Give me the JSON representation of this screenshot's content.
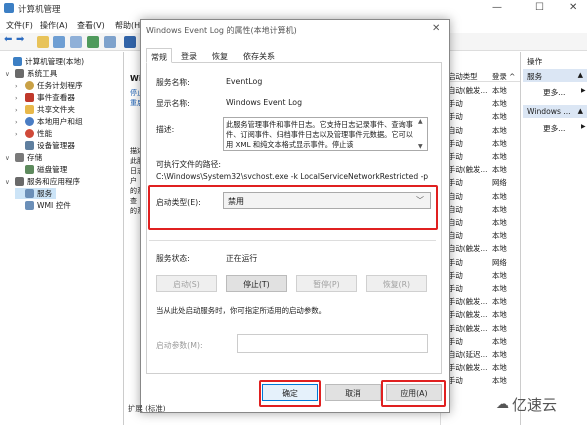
{
  "window": {
    "title": "计算机管理",
    "controls": [
      "—",
      "☐",
      "✕"
    ]
  },
  "menu": [
    "文件(F)",
    "操作(A)",
    "查看(V)",
    "帮助(H)"
  ],
  "tree": {
    "items": [
      {
        "label": "计算机管理(本地)",
        "expander": "",
        "icon_color": "#3c7fc4"
      },
      {
        "label": "系统工具",
        "expander": "∨",
        "icon_color": "#6a6a6a"
      },
      {
        "label": "任务计划程序",
        "expander": "›",
        "icon_color": "#c9a146"
      },
      {
        "label": "事件查看器",
        "expander": "›",
        "icon_color": "#c0392b"
      },
      {
        "label": "共享文件夹",
        "expander": "›",
        "icon_color": "#e8b84a"
      },
      {
        "label": "本地用户和组",
        "expander": "›",
        "icon_color": "#4a7dc4"
      },
      {
        "label": "性能",
        "expander": "›",
        "icon_color": "#d04a3a"
      },
      {
        "label": "设备管理器",
        "expander": "",
        "icon_color": "#5f7f9f"
      },
      {
        "label": "存储",
        "expander": "∨",
        "icon_color": "#7a7a7a"
      },
      {
        "label": "磁盘管理",
        "expander": "",
        "icon_color": "#5d8a5d"
      },
      {
        "label": "服务和应用程序",
        "expander": "∨",
        "icon_color": "#6a6a6a"
      },
      {
        "label": "服务",
        "expander": "",
        "icon_color": "#6b8fb8"
      },
      {
        "label": "WMI 控件",
        "expander": "",
        "icon_color": "#6b8fb8"
      }
    ]
  },
  "midpane": {
    "text": "Wi 此服务 ... 此后 日志 户报 查, 的系 提 止",
    "lines": [
      "Wi",
      "停止",
      "重启",
      "描述",
      "此服",
      "日志",
      "户",
      "的系",
      "查",
      "的系"
    ]
  },
  "list": {
    "headers": [
      "启动类型",
      "登录 ^"
    ],
    "rows": [
      [
        "自动(触发...",
        "本地"
      ],
      [
        "手动",
        "本地"
      ],
      [
        "手动",
        "本地"
      ],
      [
        "自动",
        "本地"
      ],
      [
        "手动",
        "本地"
      ],
      [
        "手动",
        "本地"
      ],
      [
        "手动(触发...",
        "本地"
      ],
      [
        "手动",
        "网络"
      ],
      [
        "自动",
        "本地"
      ],
      [
        "自动",
        "本地"
      ],
      [
        "自动",
        "本地"
      ],
      [
        "自动",
        "本地"
      ],
      [
        "自动(触发...",
        "本地"
      ],
      [
        "手动",
        "网络"
      ],
      [
        "手动",
        "本地"
      ],
      [
        "手动",
        "本地"
      ],
      [
        "手动(触发...",
        "本地"
      ],
      [
        "手动(触发...",
        "本地"
      ],
      [
        "手动(触发...",
        "本地"
      ],
      [
        "手动",
        "本地"
      ],
      [
        "自动(延迟...",
        "本地"
      ],
      [
        "手动(触发...",
        "本地"
      ],
      [
        "手动",
        "本地"
      ]
    ]
  },
  "actions": {
    "title": "操作",
    "section1": "服务",
    "more1": "更多...",
    "section2": "Windows ...",
    "more2": "更多..."
  },
  "dialog": {
    "title": "Windows Event Log 的属性(本地计算机)",
    "tabs": [
      "常规",
      "登录",
      "恢复",
      "依存关系"
    ],
    "service_name_label": "服务名称:",
    "service_name": "EventLog",
    "display_name_label": "显示名称:",
    "display_name": "Windows Event Log",
    "desc_label": "描述:",
    "description": "此服务管理事件和事件日志。它支持日志记录事件、查询事件、订阅事件、归档事件日志以及管理事件元数据。它可以用 XML 和纯文本格式显示事件。停止该",
    "exe_label": "可执行文件的路径:",
    "exe_path": "C:\\Windows\\System32\\svchost.exe -k LocalServiceNetworkRestricted -p",
    "startup_label": "启动类型(E):",
    "startup_value": "禁用",
    "status_label": "服务状态:",
    "status_value": "正在运行",
    "btn_start": "启动(S)",
    "btn_stop": "停止(T)",
    "btn_pause": "暂停(P)",
    "btn_resume": "恢复(R)",
    "hint": "当从此处启动服务时，你可指定所适用的启动参数。",
    "param_label": "启动参数(M):",
    "param_value": "",
    "ok": "确定",
    "cancel": "取消",
    "apply": "应用(A)"
  },
  "bottom_tabs": "扩展 (标准)",
  "watermark": "亿速云",
  "colors": {
    "highlight": "#e02020",
    "selection": "#cce4f7",
    "action_bar": "#dbe6f4"
  }
}
